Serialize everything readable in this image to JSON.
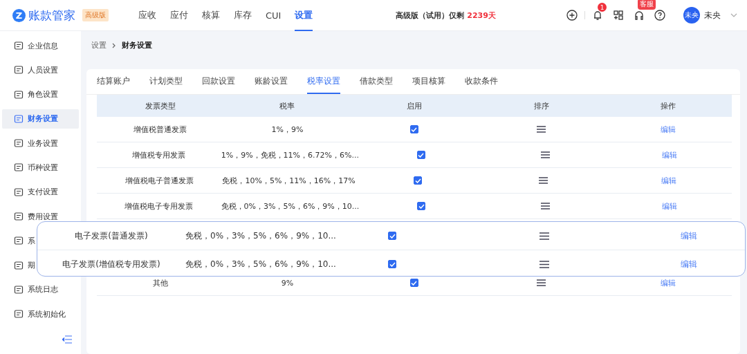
{
  "header": {
    "logo_mark": "Z",
    "app_name": "账款管家",
    "edition_badge": "高级版",
    "nav": [
      {
        "label": "应收",
        "selected": false
      },
      {
        "label": "应付",
        "selected": false
      },
      {
        "label": "核算",
        "selected": false
      },
      {
        "label": "库存",
        "selected": false
      },
      {
        "label": "CUI",
        "selected": false
      },
      {
        "label": "设置",
        "selected": true
      }
    ],
    "trial": {
      "text": "高级版（试用）仅剩",
      "days": "2239天"
    },
    "notification_count": "1",
    "service_badge": "客服",
    "avatar": "未央",
    "user_name": "未央"
  },
  "sidebar": {
    "items": [
      {
        "label": "企业信息",
        "selected": false
      },
      {
        "label": "人员设置",
        "selected": false
      },
      {
        "label": "角色设置",
        "selected": false
      },
      {
        "label": "财务设置",
        "selected": true
      },
      {
        "label": "业务设置",
        "selected": false
      },
      {
        "label": "币种设置",
        "selected": false
      },
      {
        "label": "支付设置",
        "selected": false
      },
      {
        "label": "费用设置",
        "selected": false
      },
      {
        "label": "系",
        "selected": false
      },
      {
        "label": "期",
        "selected": false
      },
      {
        "label": "系统日志",
        "selected": false
      },
      {
        "label": "系统初始化",
        "selected": false
      }
    ]
  },
  "breadcrumb": [
    "设置",
    "财务设置"
  ],
  "tabs": [
    {
      "label": "结算账户",
      "selected": false
    },
    {
      "label": "计划类型",
      "selected": false
    },
    {
      "label": "回款设置",
      "selected": false
    },
    {
      "label": "账龄设置",
      "selected": false
    },
    {
      "label": "税率设置",
      "selected": true
    },
    {
      "label": "借款类型",
      "selected": false
    },
    {
      "label": "项目核算",
      "selected": false
    },
    {
      "label": "收款条件",
      "selected": false
    }
  ],
  "table": {
    "columns": [
      "发票类型",
      "税率",
      "启用",
      "排序",
      "操作"
    ],
    "rows": [
      {
        "type": "增值税普通发票",
        "rates": "1%，9%",
        "enabled": true,
        "action": "编辑"
      },
      {
        "type": "增值税专用发票",
        "rates": "1%，9%，免税，11%，6.72%，6%...",
        "enabled": true,
        "action": "编辑"
      },
      {
        "type": "增值税电子普通发票",
        "rates": "免税，10%，5%，11%，16%，17%",
        "enabled": true,
        "action": "编辑"
      },
      {
        "type": "增值税电子专用发票",
        "rates": "免税，0%，3%，5%，6%，9%，10...",
        "enabled": true,
        "action": "编辑"
      }
    ],
    "last_row": {
      "type": "其他",
      "rates": "9%",
      "enabled": true,
      "action": "编辑"
    }
  },
  "callout": {
    "rows": [
      {
        "type": "电子发票(普通发票)",
        "rates": "免税，0%，3%，5%，6%，9%，10...",
        "enabled": true,
        "action": "编辑"
      },
      {
        "type": "电子发票(增值税专用发票)",
        "rates": "免税，0%，3%，5%，6%，9%，10...",
        "enabled": true,
        "action": "编辑"
      }
    ]
  }
}
